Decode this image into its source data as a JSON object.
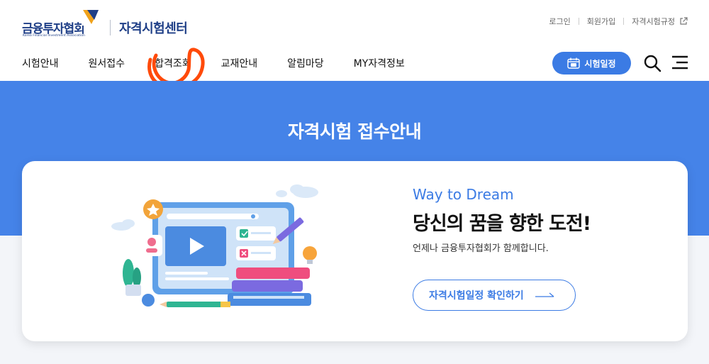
{
  "logo": {
    "name_ko": "금융투자협회",
    "name_en": "Korea Financial Investment Association",
    "subtitle": "자격시험센터"
  },
  "util_links": [
    {
      "label": "로그인"
    },
    {
      "label": "회원가입"
    },
    {
      "label": "자격시험규정"
    }
  ],
  "nav": [
    {
      "label": "시험안내"
    },
    {
      "label": "원서접수"
    },
    {
      "label": "합격조회"
    },
    {
      "label": "교재안내"
    },
    {
      "label": "알림마당"
    },
    {
      "label": "MY자격정보"
    }
  ],
  "schedule_button": {
    "label": "시험일정",
    "icon": "calendar-icon"
  },
  "hero": {
    "title": "자격시험 접수안내"
  },
  "card": {
    "tagline": "Way to Dream",
    "headline": "당신의 꿈을 향한 도전!",
    "description": "언제나 금융투자협회가 함께합니다.",
    "cta_label": "자격시험일정 확인하기"
  },
  "colors": {
    "brand_navy": "#1f3f87",
    "accent_blue": "#3b7be4",
    "hero_bg": "#4583e8",
    "annotation": "#ff4a0a"
  }
}
